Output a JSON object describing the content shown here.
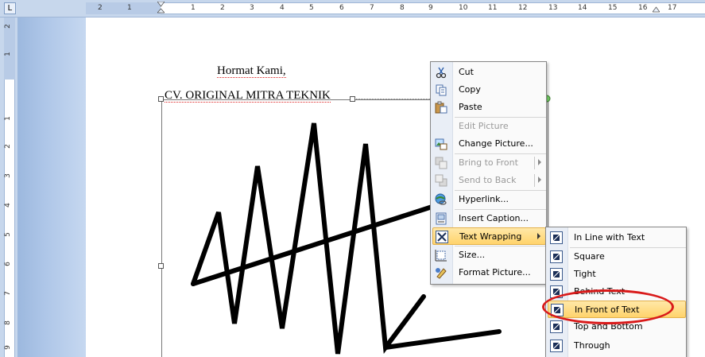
{
  "ruler": {
    "corner_glyph": "L",
    "h_labels": [
      "2",
      "1",
      "1",
      "2",
      "3",
      "4",
      "5",
      "6",
      "7",
      "8",
      "9",
      "10",
      "11",
      "12",
      "13",
      "14",
      "15",
      "16",
      "17"
    ],
    "v_labels": [
      "2",
      "1",
      "1",
      "2",
      "3",
      "4",
      "5",
      "6",
      "7",
      "8",
      "9"
    ]
  },
  "document": {
    "line1": "Hormat Kami,",
    "line2": "CV. ORIGINAL MITRA TEKNIK"
  },
  "context_menu": {
    "items": [
      {
        "label": "Cut",
        "icon": "scissors-icon",
        "enabled": true
      },
      {
        "label": "Copy",
        "icon": "copy-icon",
        "enabled": true
      },
      {
        "label": "Paste",
        "icon": "paste-icon",
        "enabled": true
      },
      {
        "label": "Edit Picture",
        "icon": "",
        "enabled": false
      },
      {
        "label": "Change Picture...",
        "icon": "change-picture-icon",
        "enabled": true
      },
      {
        "label": "Bring to Front",
        "icon": "bring-front-icon",
        "enabled": false
      },
      {
        "label": "Send to Back",
        "icon": "send-back-icon",
        "enabled": false
      },
      {
        "label": "Hyperlink...",
        "icon": "hyperlink-icon",
        "enabled": true
      },
      {
        "label": "Insert Caption...",
        "icon": "caption-icon",
        "enabled": true
      },
      {
        "label": "Text Wrapping",
        "icon": "text-wrapping-icon",
        "enabled": true
      },
      {
        "label": "Size...",
        "icon": "size-icon",
        "enabled": true
      },
      {
        "label": "Format Picture...",
        "icon": "format-picture-icon",
        "enabled": true
      }
    ]
  },
  "wrap_submenu": {
    "items": [
      {
        "label": "In Line with Text"
      },
      {
        "label": "Square"
      },
      {
        "label": "Tight"
      },
      {
        "label": "Behind Text"
      },
      {
        "label": "In Front of Text"
      },
      {
        "label": "Top and Bottom"
      },
      {
        "label": "Through"
      }
    ]
  },
  "colors": {
    "highlight": "#ffd36b",
    "annotation_red": "#d91a1a",
    "ruler_blue": "#c7d7ec"
  }
}
